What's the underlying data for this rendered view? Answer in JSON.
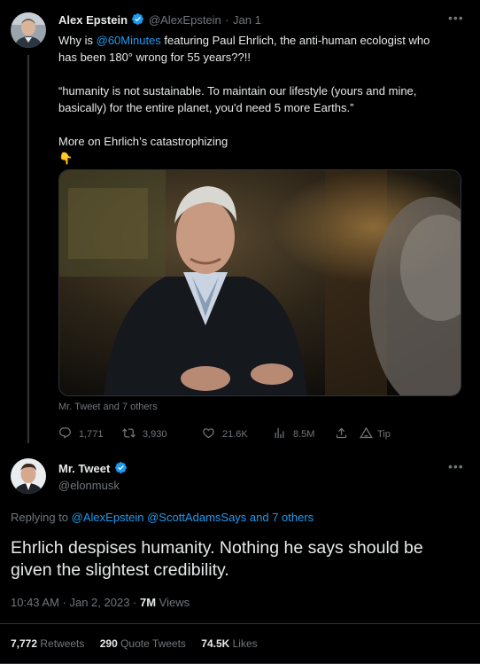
{
  "tweet1": {
    "author_name": "Alex Epstein",
    "handle": "@AlexEpstein",
    "separator": "·",
    "date": "Jan 1",
    "line1_pre": "Why is ",
    "line1_mention": "@60Minutes",
    "line1_post": " featuring Paul Ehrlich, the anti-human ecologist who",
    "line2": "has been 180° wrong for 55 years??!!",
    "para2_line1": "“humanity is not sustainable. To maintain our lifestyle (yours and mine,",
    "para2_line2": "basically) for the entire planet, you'd need 5 more Earths.”",
    "para3": "More on Ehrlich’s catastrophizing",
    "emoji": "👇",
    "media_tag": "Mr. Tweet and 7 others",
    "replies": "1,771",
    "retweets": "3,930",
    "likes": "21.6K",
    "views": "8.5M",
    "tip": "Tip"
  },
  "tweet2": {
    "author_name": "Mr. Tweet",
    "handle": "@elonmusk",
    "replying_to": "Replying to ",
    "replying_mentions": "@AlexEpstein @ScottAdamsSays and 7 others",
    "text_line1": "Ehrlich despises humanity. Nothing he says should be",
    "text_line2": "given the slightest credibility.",
    "time": "10:43 AM · Jan 2, 2023 · ",
    "views_count": "7M",
    "views_label": " Views",
    "retweets_count": "7,772",
    "retweets_label": " Retweets",
    "quotes_count": "290",
    "quotes_label": " Quote Tweets",
    "likes_count": "74.5K",
    "likes_label": " Likes"
  },
  "colors": {
    "background": "#000000",
    "text": "#e7e9ea",
    "muted": "#71767b",
    "link": "#1d9bf0",
    "verified": "#1d9bf0",
    "divider": "#2f3336"
  },
  "icons": {
    "more": "more-icon",
    "verified": "verified-badge-icon",
    "reply": "reply-icon",
    "retweet": "retweet-icon",
    "like": "heart-icon",
    "views": "views-icon",
    "share": "share-icon",
    "tip": "tip-icon"
  }
}
